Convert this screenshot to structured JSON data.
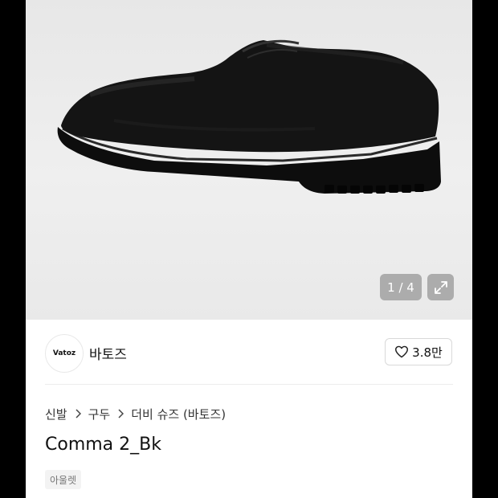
{
  "gallery": {
    "pager": "1 / 4",
    "expand_icon": "expand-icon"
  },
  "brand": {
    "logo_text": "Vatoz",
    "name": "바토즈",
    "likes": "3.8만",
    "like_icon": "heart-outline-icon"
  },
  "breadcrumb": [
    "신발",
    "구두",
    "더비 슈즈 (바토즈)"
  ],
  "product": {
    "title": "Comma 2_Bk",
    "tag": "아울렛"
  }
}
